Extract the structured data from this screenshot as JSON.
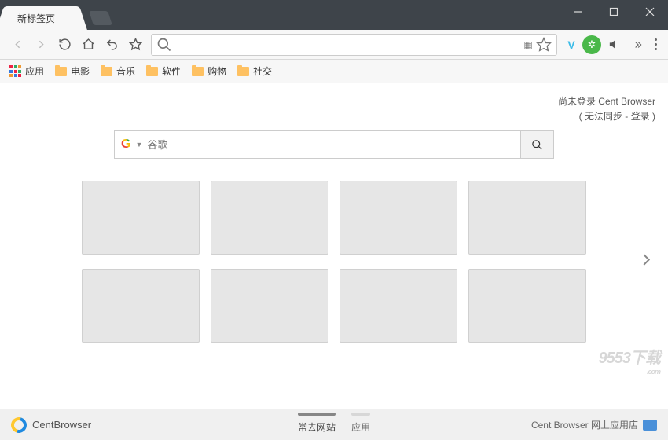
{
  "tab": {
    "title": "新标签页"
  },
  "address_bar": {
    "value": "",
    "placeholder": ""
  },
  "bookmarks": {
    "apps_label": "应用",
    "items": [
      {
        "label": "电影"
      },
      {
        "label": "音乐"
      },
      {
        "label": "软件"
      },
      {
        "label": "购物"
      },
      {
        "label": "社交"
      }
    ]
  },
  "login_status": {
    "line1": "尚未登录 Cent Browser",
    "line2_prefix": "( 无法同步 - ",
    "login_text": "登录",
    "line2_suffix": " )"
  },
  "search": {
    "placeholder": "谷歌"
  },
  "footer": {
    "brand": "CentBrowser",
    "tabs": [
      {
        "label": "常去网站",
        "active": true
      },
      {
        "label": "应用",
        "active": false
      }
    ],
    "webstore": "Cent Browser 网上应用店"
  },
  "watermark": {
    "main": "9553下载",
    "sub": ".com"
  }
}
